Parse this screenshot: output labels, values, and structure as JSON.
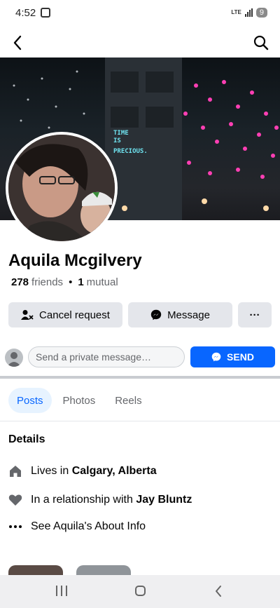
{
  "status": {
    "time": "4:52",
    "network": "LTE",
    "battery": "9"
  },
  "profile": {
    "name": "Aquila Mcgilvery",
    "friends_count": "278",
    "friends_label": "friends",
    "separator": "•",
    "mutual_count": "1",
    "mutual_label": "mutual",
    "cover_text_line1": "TIME",
    "cover_text_line2": "IS",
    "cover_text_line3": "PRECIOUS."
  },
  "actions": {
    "cancel_label": "Cancel request",
    "message_label": "Message",
    "more_label": "···"
  },
  "private_message": {
    "placeholder": "Send a private message…",
    "send_label": "SEND"
  },
  "tabs": [
    {
      "label": "Posts",
      "active": true
    },
    {
      "label": "Photos",
      "active": false
    },
    {
      "label": "Reels",
      "active": false
    }
  ],
  "details": {
    "title": "Details",
    "lives_prefix": "Lives in ",
    "lives_place": "Calgary, Alberta",
    "relationship_prefix": "In a relationship with ",
    "relationship_person": "Jay Bluntz",
    "about_label": "See Aquila's About Info"
  },
  "colors": {
    "accent": "#0866ff",
    "button_bg": "#e4e6eb",
    "tab_active_bg": "#e7f3ff"
  }
}
